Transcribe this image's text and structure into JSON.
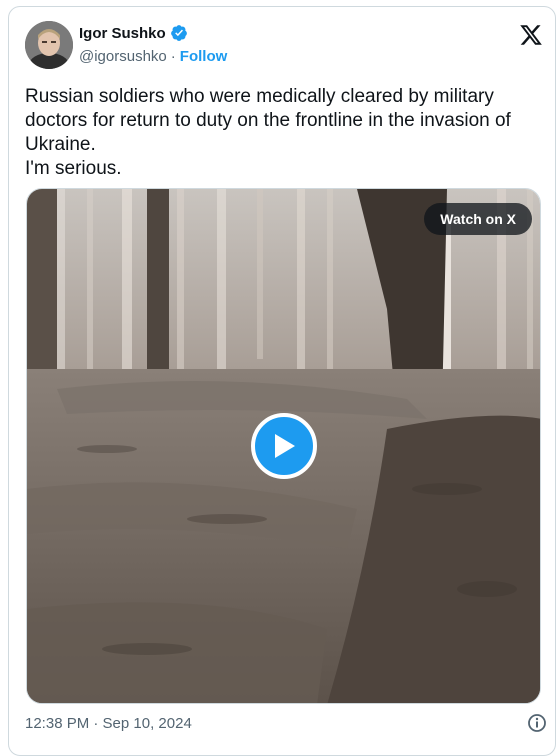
{
  "author": {
    "name": "Igor Sushko",
    "handle": "@igorsushko",
    "separator": "·",
    "follow_label": "Follow",
    "verified_icon": "verified-badge-icon",
    "brand_color": "#1d9bf0"
  },
  "tweet": {
    "text": "Russian soldiers who were medically cleared by military doctors for return to duty on the frontline in the invasion of Ukraine.\nI'm serious."
  },
  "media": {
    "watch_label": "Watch on X",
    "play_icon": "play-icon"
  },
  "footer": {
    "timestamp": "12:38 PM · Sep 10, 2024",
    "info_icon": "info-icon"
  },
  "brand": {
    "logo_icon": "x-logo-icon"
  }
}
